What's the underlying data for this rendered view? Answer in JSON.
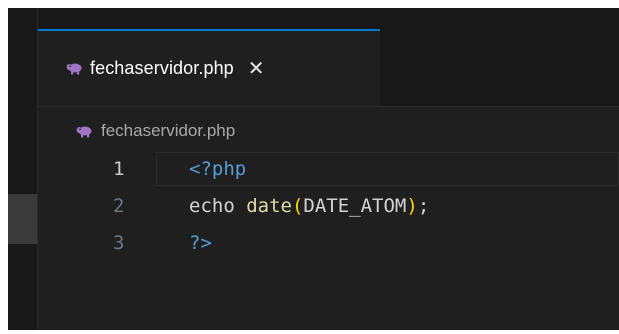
{
  "tab": {
    "title": "fechaservidor.php",
    "close_glyph": "✕",
    "icon": "php-elephant-icon"
  },
  "breadcrumb": {
    "label": "fechaservidor.php",
    "icon": "php-elephant-icon"
  },
  "editor": {
    "active_line": 1,
    "lines": [
      {
        "number": "1",
        "tokens": [
          {
            "text": "<?php",
            "kind": "tag"
          }
        ]
      },
      {
        "number": "2",
        "tokens": [
          {
            "text": "echo ",
            "kind": "plain"
          },
          {
            "text": "date",
            "kind": "fn"
          },
          {
            "text": "(",
            "kind": "paren"
          },
          {
            "text": "DATE_ATOM",
            "kind": "const"
          },
          {
            "text": ")",
            "kind": "paren"
          },
          {
            "text": ";",
            "kind": "plain"
          }
        ]
      },
      {
        "number": "3",
        "tokens": [
          {
            "text": "?>",
            "kind": "tag"
          }
        ]
      }
    ]
  },
  "colors": {
    "tab_accent": "#0078d4",
    "php_icon": "#a074c4",
    "keyword_tag": "#569cd6",
    "function": "#dcdcaa",
    "bracket": "#ffd700"
  }
}
